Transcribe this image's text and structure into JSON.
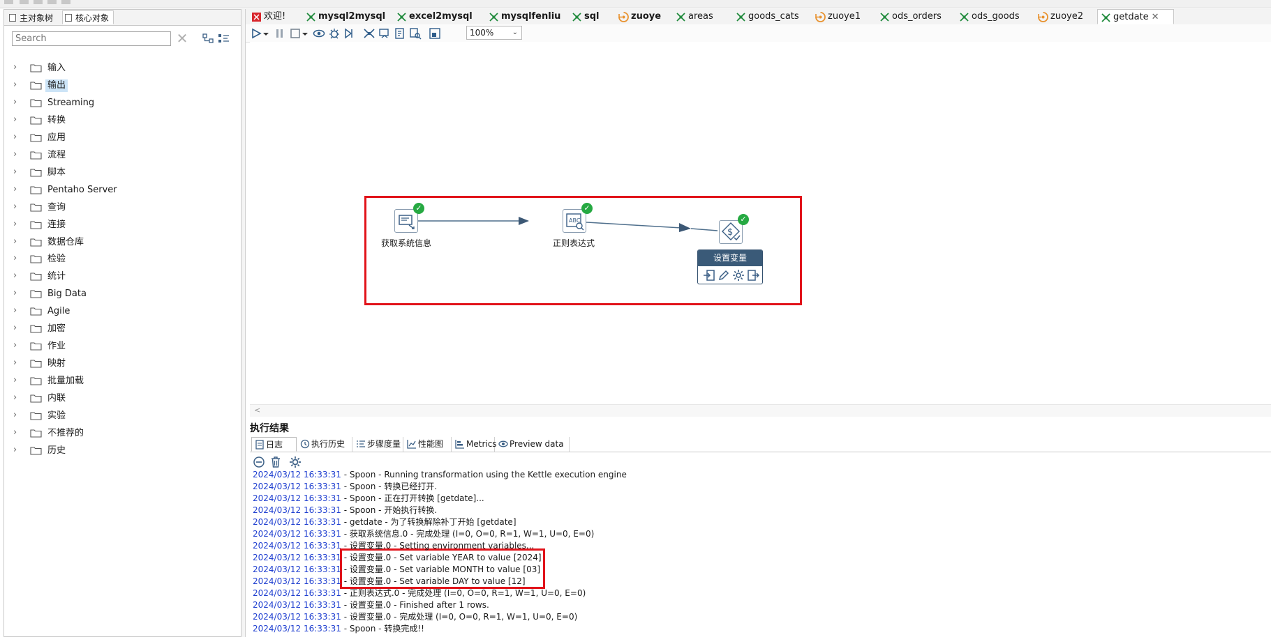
{
  "left_panel": {
    "tabs": [
      "主对象树",
      "核心对象"
    ],
    "active_tab": 1,
    "search": {
      "placeholder": "Search",
      "value": ""
    },
    "tree": [
      {
        "label": "输入"
      },
      {
        "label": "输出",
        "selected": true
      },
      {
        "label": "Streaming"
      },
      {
        "label": "转换"
      },
      {
        "label": "应用"
      },
      {
        "label": "流程"
      },
      {
        "label": "脚本"
      },
      {
        "label": "Pentaho Server"
      },
      {
        "label": "查询"
      },
      {
        "label": "连接"
      },
      {
        "label": "数据仓库"
      },
      {
        "label": "检验"
      },
      {
        "label": "统计"
      },
      {
        "label": "Big Data"
      },
      {
        "label": "Agile"
      },
      {
        "label": "加密"
      },
      {
        "label": "作业"
      },
      {
        "label": "映射"
      },
      {
        "label": "批量加载"
      },
      {
        "label": "内联"
      },
      {
        "label": "实验"
      },
      {
        "label": "不推荐的"
      },
      {
        "label": "历史"
      }
    ]
  },
  "editor_tabs": [
    {
      "label": "欢迎!",
      "kind": "welcome",
      "bold": false
    },
    {
      "label": "mysql2mysql",
      "kind": "trans",
      "bold": true
    },
    {
      "label": "excel2mysql",
      "kind": "trans",
      "bold": true
    },
    {
      "label": "mysqlfenliu",
      "kind": "trans",
      "bold": true
    },
    {
      "label": "sql",
      "kind": "trans",
      "bold": true
    },
    {
      "label": "zuoye",
      "kind": "job",
      "bold": true
    },
    {
      "label": "areas",
      "kind": "trans",
      "bold": false
    },
    {
      "label": "goods_cats",
      "kind": "trans",
      "bold": false
    },
    {
      "label": "zuoye1",
      "kind": "job",
      "bold": false
    },
    {
      "label": "ods_orders",
      "kind": "trans",
      "bold": false
    },
    {
      "label": "ods_goods",
      "kind": "trans",
      "bold": false
    },
    {
      "label": "zuoye2",
      "kind": "job",
      "bold": false
    },
    {
      "label": "getdate",
      "kind": "trans",
      "bold": false,
      "active": true,
      "close": "✕"
    }
  ],
  "toolbar": {
    "zoom": "100%",
    "icons": [
      "run-icon",
      "run-options-icon",
      "pause-icon",
      "stop-icon",
      "stop-options-icon",
      "preview-icon",
      "debug-icon",
      "replay-icon",
      "verify-icon",
      "impact-icon",
      "sql-icon",
      "explore-db-icon",
      "show-results-icon"
    ]
  },
  "steps": [
    {
      "name": "获取系统信息"
    },
    {
      "name": "正则表达式"
    },
    {
      "name": "设置变量"
    }
  ],
  "hop_menu": {
    "title": "设置变量",
    "items": [
      "input-icon",
      "edit-icon",
      "settings-icon",
      "output-icon"
    ]
  },
  "results": {
    "title": "执行结果",
    "tabs": [
      {
        "label": "日志",
        "icon": "log-icon",
        "active": true
      },
      {
        "label": "执行历史",
        "icon": "history-icon"
      },
      {
        "label": "步骤度量",
        "icon": "step-metrics-icon"
      },
      {
        "label": "性能图",
        "icon": "performance-icon"
      },
      {
        "label": "Metrics",
        "icon": "metrics-icon"
      },
      {
        "label": "Preview data",
        "icon": "preview-icon"
      }
    ],
    "log_tools": [
      "collapse-icon",
      "clear-log-icon",
      "log-settings-icon"
    ],
    "log_lines": [
      {
        "ts": "2024/03/12 16:33:31",
        "msg": " - Spoon - Running transformation using the Kettle execution engine"
      },
      {
        "ts": "2024/03/12 16:33:31",
        "msg": " - Spoon - 转换已经打开."
      },
      {
        "ts": "2024/03/12 16:33:31",
        "msg": " - Spoon - 正在打开转换 [getdate]..."
      },
      {
        "ts": "2024/03/12 16:33:31",
        "msg": " - Spoon - 开始执行转换."
      },
      {
        "ts": "2024/03/12 16:33:31",
        "msg": " - getdate - 为了转换解除补丁开始  [getdate]"
      },
      {
        "ts": "2024/03/12 16:33:31",
        "msg": " - 获取系统信息.0 - 完成处理 (I=0, O=0, R=1, W=1, U=0, E=0)"
      },
      {
        "ts": "2024/03/12 16:33:31",
        "msg": " - 设置变量.0 - Setting environment variables..."
      },
      {
        "ts": "2024/03/12 16:33:31",
        "msg": " - 设置变量.0 - Set variable YEAR to value [2024]"
      },
      {
        "ts": "2024/03/12 16:33:31",
        "msg": " - 设置变量.0 - Set variable MONTH to value [03]"
      },
      {
        "ts": "2024/03/12 16:33:31",
        "msg": " - 设置变量.0 - Set variable DAY to value [12]"
      },
      {
        "ts": "2024/03/12 16:33:31",
        "msg": " - 正则表达式.0 - 完成处理 (I=0, O=0, R=1, W=1, U=0, E=0)"
      },
      {
        "ts": "2024/03/12 16:33:31",
        "msg": " - 设置变量.0 - Finished after 1 rows."
      },
      {
        "ts": "2024/03/12 16:33:31",
        "msg": " - 设置变量.0 - 完成处理 (I=0, O=0, R=1, W=1, U=0, E=0)"
      },
      {
        "ts": "2024/03/12 16:33:31",
        "msg": " - Spoon - 转换完成!!"
      }
    ]
  },
  "colors": {
    "accent_red": "#e1131a",
    "timestamp_blue": "#1f3fd0",
    "check_green": "#26a942",
    "step_menu_header": "#3a5a78"
  }
}
